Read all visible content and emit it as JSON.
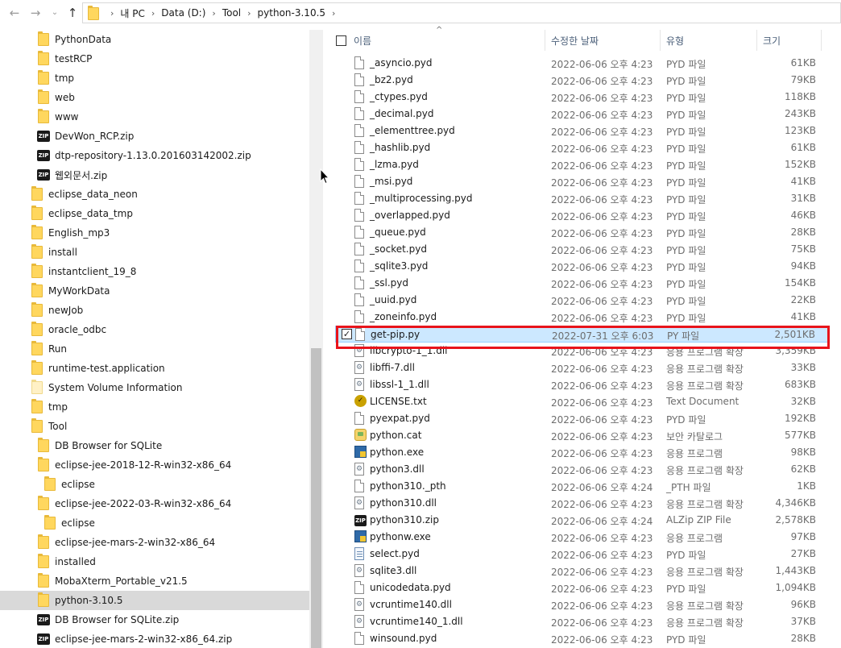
{
  "address": {
    "crumbs": [
      "내 PC",
      "Data (D:)",
      "Tool",
      "python-3.10.5"
    ]
  },
  "tree": [
    {
      "label": "PythonData",
      "icon": "folder-icon",
      "indent": 2
    },
    {
      "label": "testRCP",
      "icon": "folder-icon",
      "indent": 2
    },
    {
      "label": "tmp",
      "icon": "folder-icon",
      "indent": 2
    },
    {
      "label": "web",
      "icon": "folder-icon",
      "indent": 2
    },
    {
      "label": "www",
      "icon": "folder-icon",
      "indent": 2
    },
    {
      "label": "DevWon_RCP.zip",
      "icon": "zip-icon",
      "indent": 2
    },
    {
      "label": "dtp-repository-1.13.0.201603142002.zip",
      "icon": "zip-icon",
      "indent": 2
    },
    {
      "label": "웹외문서.zip",
      "icon": "zip-icon",
      "indent": 2
    },
    {
      "label": "eclipse_data_neon",
      "icon": "folder-icon",
      "indent": 1
    },
    {
      "label": "eclipse_data_tmp",
      "icon": "folder-icon",
      "indent": 1
    },
    {
      "label": "English_mp3",
      "icon": "folder-icon",
      "indent": 1
    },
    {
      "label": "install",
      "icon": "folder-icon",
      "indent": 1
    },
    {
      "label": "instantclient_19_8",
      "icon": "folder-icon",
      "indent": 1
    },
    {
      "label": "MyWorkData",
      "icon": "folder-icon",
      "indent": 1
    },
    {
      "label": "newJob",
      "icon": "folder-icon",
      "indent": 1
    },
    {
      "label": "oracle_odbc",
      "icon": "folder-icon",
      "indent": 1
    },
    {
      "label": "Run",
      "icon": "folder-icon",
      "indent": 1
    },
    {
      "label": "runtime-test.application",
      "icon": "folder-icon",
      "indent": 1
    },
    {
      "label": "System Volume Information",
      "icon": "folder-faded-icon",
      "indent": 1
    },
    {
      "label": "tmp",
      "icon": "folder-icon",
      "indent": 1
    },
    {
      "label": "Tool",
      "icon": "folder-icon",
      "indent": 1
    },
    {
      "label": "DB Browser for SQLite",
      "icon": "folder-icon",
      "indent": 2
    },
    {
      "label": "eclipse-jee-2018-12-R-win32-x86_64",
      "icon": "folder-icon",
      "indent": 2
    },
    {
      "label": "eclipse",
      "icon": "folder-icon",
      "indent": 3
    },
    {
      "label": "eclipse-jee-2022-03-R-win32-x86_64",
      "icon": "folder-icon",
      "indent": 2
    },
    {
      "label": "eclipse",
      "icon": "folder-icon",
      "indent": 3
    },
    {
      "label": "eclipse-jee-mars-2-win32-x86_64",
      "icon": "folder-icon",
      "indent": 2
    },
    {
      "label": "installed",
      "icon": "folder-icon",
      "indent": 2
    },
    {
      "label": "MobaXterm_Portable_v21.5",
      "icon": "folder-icon",
      "indent": 2
    },
    {
      "label": "python-3.10.5",
      "icon": "folder-icon",
      "indent": 2,
      "selected": true
    },
    {
      "label": "DB Browser for SQLite.zip",
      "icon": "zip-icon",
      "indent": 2
    },
    {
      "label": "eclipse-jee-mars-2-win32-x86_64.zip",
      "icon": "zip-icon",
      "indent": 2
    }
  ],
  "columns": {
    "name": "이름",
    "date": "수정한 날짜",
    "type": "유형",
    "size": "크기"
  },
  "files": [
    {
      "name": "_asyncio.pyd",
      "date": "2022-06-06 오후 4:23",
      "type": "PYD 파일",
      "size": "61KB",
      "icon": "doc"
    },
    {
      "name": "_bz2.pyd",
      "date": "2022-06-06 오후 4:23",
      "type": "PYD 파일",
      "size": "79KB",
      "icon": "doc"
    },
    {
      "name": "_ctypes.pyd",
      "date": "2022-06-06 오후 4:23",
      "type": "PYD 파일",
      "size": "118KB",
      "icon": "doc"
    },
    {
      "name": "_decimal.pyd",
      "date": "2022-06-06 오후 4:23",
      "type": "PYD 파일",
      "size": "243KB",
      "icon": "doc"
    },
    {
      "name": "_elementtree.pyd",
      "date": "2022-06-06 오후 4:23",
      "type": "PYD 파일",
      "size": "123KB",
      "icon": "doc"
    },
    {
      "name": "_hashlib.pyd",
      "date": "2022-06-06 오후 4:23",
      "type": "PYD 파일",
      "size": "61KB",
      "icon": "doc"
    },
    {
      "name": "_lzma.pyd",
      "date": "2022-06-06 오후 4:23",
      "type": "PYD 파일",
      "size": "152KB",
      "icon": "doc"
    },
    {
      "name": "_msi.pyd",
      "date": "2022-06-06 오후 4:23",
      "type": "PYD 파일",
      "size": "41KB",
      "icon": "doc"
    },
    {
      "name": "_multiprocessing.pyd",
      "date": "2022-06-06 오후 4:23",
      "type": "PYD 파일",
      "size": "31KB",
      "icon": "doc"
    },
    {
      "name": "_overlapped.pyd",
      "date": "2022-06-06 오후 4:23",
      "type": "PYD 파일",
      "size": "46KB",
      "icon": "doc"
    },
    {
      "name": "_queue.pyd",
      "date": "2022-06-06 오후 4:23",
      "type": "PYD 파일",
      "size": "28KB",
      "icon": "doc"
    },
    {
      "name": "_socket.pyd",
      "date": "2022-06-06 오후 4:23",
      "type": "PYD 파일",
      "size": "75KB",
      "icon": "doc"
    },
    {
      "name": "_sqlite3.pyd",
      "date": "2022-06-06 오후 4:23",
      "type": "PYD 파일",
      "size": "94KB",
      "icon": "doc"
    },
    {
      "name": "_ssl.pyd",
      "date": "2022-06-06 오후 4:23",
      "type": "PYD 파일",
      "size": "154KB",
      "icon": "doc"
    },
    {
      "name": "_uuid.pyd",
      "date": "2022-06-06 오후 4:23",
      "type": "PYD 파일",
      "size": "22KB",
      "icon": "doc"
    },
    {
      "name": "_zoneinfo.pyd",
      "date": "2022-06-06 오후 4:23",
      "type": "PYD 파일",
      "size": "41KB",
      "icon": "doc"
    },
    {
      "name": "get-pip.py",
      "date": "2022-07-31 오후 6:03",
      "type": "PY 파일",
      "size": "2,501KB",
      "icon": "doc",
      "selected": true
    },
    {
      "name": "libcrypto-1_1.dll",
      "date": "2022-06-06 오후 4:23",
      "type": "응용 프로그램 확장",
      "size": "3,359KB",
      "icon": "dll"
    },
    {
      "name": "libffi-7.dll",
      "date": "2022-06-06 오후 4:23",
      "type": "응용 프로그램 확장",
      "size": "33KB",
      "icon": "dll"
    },
    {
      "name": "libssl-1_1.dll",
      "date": "2022-06-06 오후 4:23",
      "type": "응용 프로그램 확장",
      "size": "683KB",
      "icon": "dll"
    },
    {
      "name": "LICENSE.txt",
      "date": "2022-06-06 오후 4:23",
      "type": "Text Document",
      "size": "32KB",
      "icon": "lic"
    },
    {
      "name": "pyexpat.pyd",
      "date": "2022-06-06 오후 4:23",
      "type": "PYD 파일",
      "size": "192KB",
      "icon": "doc"
    },
    {
      "name": "python.cat",
      "date": "2022-06-06 오후 4:23",
      "type": "보안 카탈로그",
      "size": "577KB",
      "icon": "cat"
    },
    {
      "name": "python.exe",
      "date": "2022-06-06 오후 4:23",
      "type": "응용 프로그램",
      "size": "98KB",
      "icon": "exe"
    },
    {
      "name": "python3.dll",
      "date": "2022-06-06 오후 4:23",
      "type": "응용 프로그램 확장",
      "size": "62KB",
      "icon": "dll"
    },
    {
      "name": "python310._pth",
      "date": "2022-06-06 오후 4:24",
      "type": "_PTH 파일",
      "size": "1KB",
      "icon": "doc"
    },
    {
      "name": "python310.dll",
      "date": "2022-06-06 오후 4:23",
      "type": "응용 프로그램 확장",
      "size": "4,346KB",
      "icon": "dll"
    },
    {
      "name": "python310.zip",
      "date": "2022-06-06 오후 4:24",
      "type": "ALZip ZIP File",
      "size": "2,578KB",
      "icon": "zip"
    },
    {
      "name": "pythonw.exe",
      "date": "2022-06-06 오후 4:23",
      "type": "응용 프로그램",
      "size": "97KB",
      "icon": "exe"
    },
    {
      "name": "select.pyd",
      "date": "2022-06-06 오후 4:23",
      "type": "PYD 파일",
      "size": "27KB",
      "icon": "pyfile"
    },
    {
      "name": "sqlite3.dll",
      "date": "2022-06-06 오후 4:23",
      "type": "응용 프로그램 확장",
      "size": "1,443KB",
      "icon": "dll"
    },
    {
      "name": "unicodedata.pyd",
      "date": "2022-06-06 오후 4:23",
      "type": "PYD 파일",
      "size": "1,094KB",
      "icon": "doc"
    },
    {
      "name": "vcruntime140.dll",
      "date": "2022-06-06 오후 4:23",
      "type": "응용 프로그램 확장",
      "size": "96KB",
      "icon": "dll"
    },
    {
      "name": "vcruntime140_1.dll",
      "date": "2022-06-06 오후 4:23",
      "type": "응용 프로그램 확장",
      "size": "37KB",
      "icon": "dll"
    },
    {
      "name": "winsound.pyd",
      "date": "2022-06-06 오후 4:23",
      "type": "PYD 파일",
      "size": "28KB",
      "icon": "doc"
    }
  ],
  "colors": {
    "selected_row": "#cce8ff",
    "tree_selected": "#d9d9d9",
    "highlight_border": "#e8141b",
    "folder": "#ffd75e"
  }
}
